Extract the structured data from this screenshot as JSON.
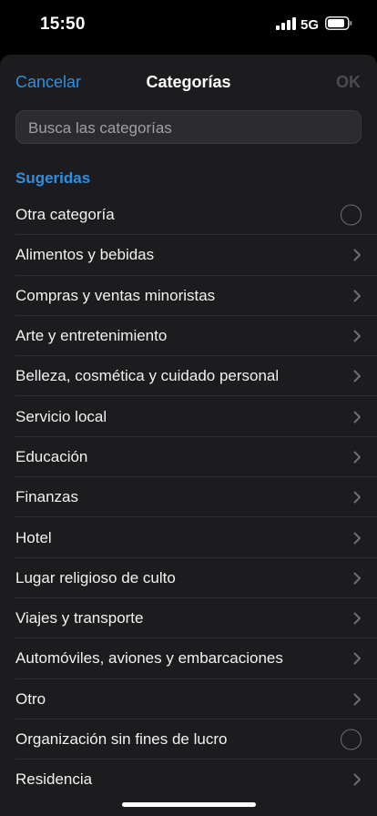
{
  "status_bar": {
    "time": "15:50",
    "network": "5G"
  },
  "nav": {
    "cancel_label": "Cancelar",
    "title": "Categorías",
    "ok_label": "OK"
  },
  "search": {
    "placeholder": "Busca las categorías"
  },
  "section": {
    "header": "Sugeridas"
  },
  "categories": [
    {
      "label": "Otra categoría",
      "accessory": "radio"
    },
    {
      "label": "Alimentos y bebidas",
      "accessory": "chevron"
    },
    {
      "label": "Compras y ventas minoristas",
      "accessory": "chevron"
    },
    {
      "label": "Arte y entretenimiento",
      "accessory": "chevron"
    },
    {
      "label": "Belleza, cosmética y cuidado personal",
      "accessory": "chevron"
    },
    {
      "label": "Servicio local",
      "accessory": "chevron"
    },
    {
      "label": "Educación",
      "accessory": "chevron"
    },
    {
      "label": "Finanzas",
      "accessory": "chevron"
    },
    {
      "label": "Hotel",
      "accessory": "chevron"
    },
    {
      "label": "Lugar religioso de culto",
      "accessory": "chevron"
    },
    {
      "label": "Viajes y transporte",
      "accessory": "chevron"
    },
    {
      "label": "Automóviles, aviones y embarcaciones",
      "accessory": "chevron"
    },
    {
      "label": "Otro",
      "accessory": "chevron"
    },
    {
      "label": "Organización sin fines de lucro",
      "accessory": "radio"
    },
    {
      "label": "Residencia",
      "accessory": "chevron"
    }
  ],
  "colors": {
    "accent": "#2d8fe3",
    "background": "#1c1c1e",
    "disabled": "#4c4c50"
  }
}
